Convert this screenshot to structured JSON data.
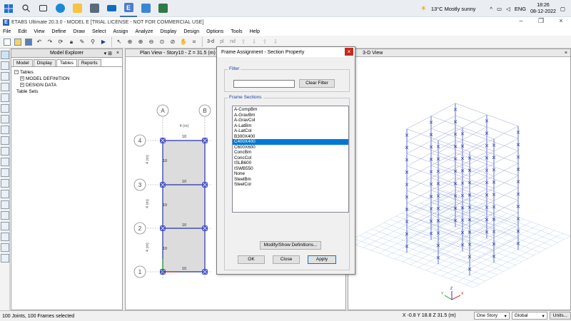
{
  "taskbar": {
    "weather": "13°C  Mostly sunny",
    "language": "ENG",
    "time": "18:26",
    "date": "08-12-2022",
    "etabs_icon_letter": "E"
  },
  "window": {
    "title": "ETABS Ultimate 20.3.0 - MODEL E  [TRIAL LICENSE - NOT FOR COMMERCIAL USE]",
    "logo_letter": "E"
  },
  "menu": [
    "File",
    "Edit",
    "View",
    "Define",
    "Draw",
    "Select",
    "Assign",
    "Analyze",
    "Display",
    "Design",
    "Options",
    "Tools",
    "Help"
  ],
  "toolbar": {
    "view_3d": "3-d",
    "view_plan": "pl",
    "view_elev": "nd"
  },
  "explorer": {
    "title": "Model Explorer",
    "pin": "▾ ⊞",
    "close": "×",
    "tabs": [
      "Model",
      "Display",
      "Tables",
      "Reports"
    ],
    "selected_tab": "Tables",
    "tree": {
      "root": "Tables",
      "children": [
        "MODEL DEFINITION",
        "DESIGN DATA"
      ],
      "table_sets": "Table Sets"
    }
  },
  "plan": {
    "title": "Plan View - Story10 - Z = 31.5 (m)",
    "close": "×",
    "grid_cols": [
      "A",
      "B"
    ],
    "grid_rows": [
      "4",
      "3",
      "2",
      "1"
    ],
    "dim_x": "4 (m)",
    "dim_y": "4 (m)",
    "beam_label": "10",
    "col_label": "10"
  },
  "view3d": {
    "title": "3-D View",
    "close": "×",
    "axes": [
      "X",
      "Y",
      "Z"
    ]
  },
  "dialog": {
    "title": "Frame Assignment - Section Property",
    "close": "×",
    "filter_label": "Filter",
    "filter_value": "",
    "clear_filter": "Clear Filter",
    "sections_label": "Frame Sections",
    "sections": [
      "A-CompBm",
      "A-GravBm",
      "A-GravCol",
      "A-LatBm",
      "A-LatCol",
      "B300X400",
      "C400X400",
      "C600X600",
      "ConcBm",
      "ConcCol",
      "ISLB600",
      "ISWB550",
      "None",
      "SteelBm",
      "SteelCol"
    ],
    "selected_section": "C400X400",
    "modify_button": "Modify/Show Definitions...",
    "ok_button": "OK",
    "close_button": "Close",
    "apply_button": "Apply"
  },
  "status": {
    "left": "100 Joints, 100 Frames selected",
    "coords": "X -0.8  Y 18.8  Z 31.5 (m)",
    "story_dropdown": "One Story",
    "coord_dropdown": "Global",
    "units_button": "Units..."
  },
  "colors": {
    "selection": "#0078d7",
    "frame_blue": "#2233aa",
    "grid_line": "#888888",
    "close_red": "#c42b1c"
  }
}
